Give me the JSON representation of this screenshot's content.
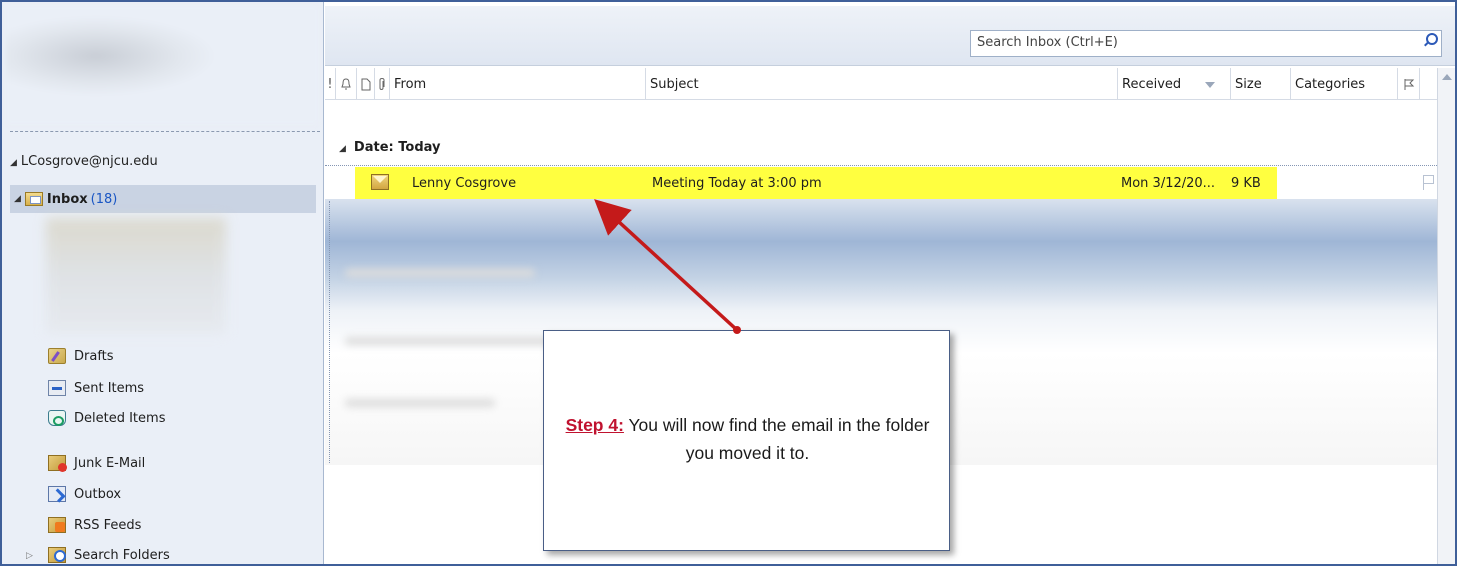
{
  "nav": {
    "account": "LCosgrove@njcu.edu",
    "inbox": {
      "label": "Inbox",
      "count": "(18)"
    },
    "folders": [
      {
        "label": "Drafts",
        "icon": "drafts-folder-icon"
      },
      {
        "label": "Sent Items",
        "icon": "sent-items-folder-icon"
      },
      {
        "label": "Deleted Items",
        "icon": "deleted-items-folder-icon"
      },
      {
        "label": "Junk E-Mail",
        "icon": "junk-email-folder-icon"
      },
      {
        "label": "Outbox",
        "icon": "outbox-folder-icon"
      },
      {
        "label": "RSS Feeds",
        "icon": "rss-feeds-folder-icon"
      },
      {
        "label": "Search Folders",
        "icon": "search-folders-icon"
      }
    ]
  },
  "search": {
    "placeholder": "Search Inbox (Ctrl+E)"
  },
  "columns": {
    "importance": "!",
    "reminder": "🔔",
    "icon": "🗋",
    "attachment": "📎",
    "from": "From",
    "subject": "Subject",
    "received": "Received",
    "size": "Size",
    "categories": "Categories",
    "flag": "⚐"
  },
  "group": {
    "label": "Date: Today"
  },
  "message": {
    "from": "Lenny Cosgrove",
    "subject": "Meeting Today at 3:00 pm",
    "received": "Mon 3/12/20...",
    "size": "9 KB"
  },
  "callout": {
    "step": "Step 4:",
    "text": " You will now find the email in the folder you moved it to."
  },
  "colors": {
    "highlight": "#ffff40",
    "arrow": "#c41a1a",
    "step": "#c0122f",
    "unread_count": "#1a56c4"
  }
}
